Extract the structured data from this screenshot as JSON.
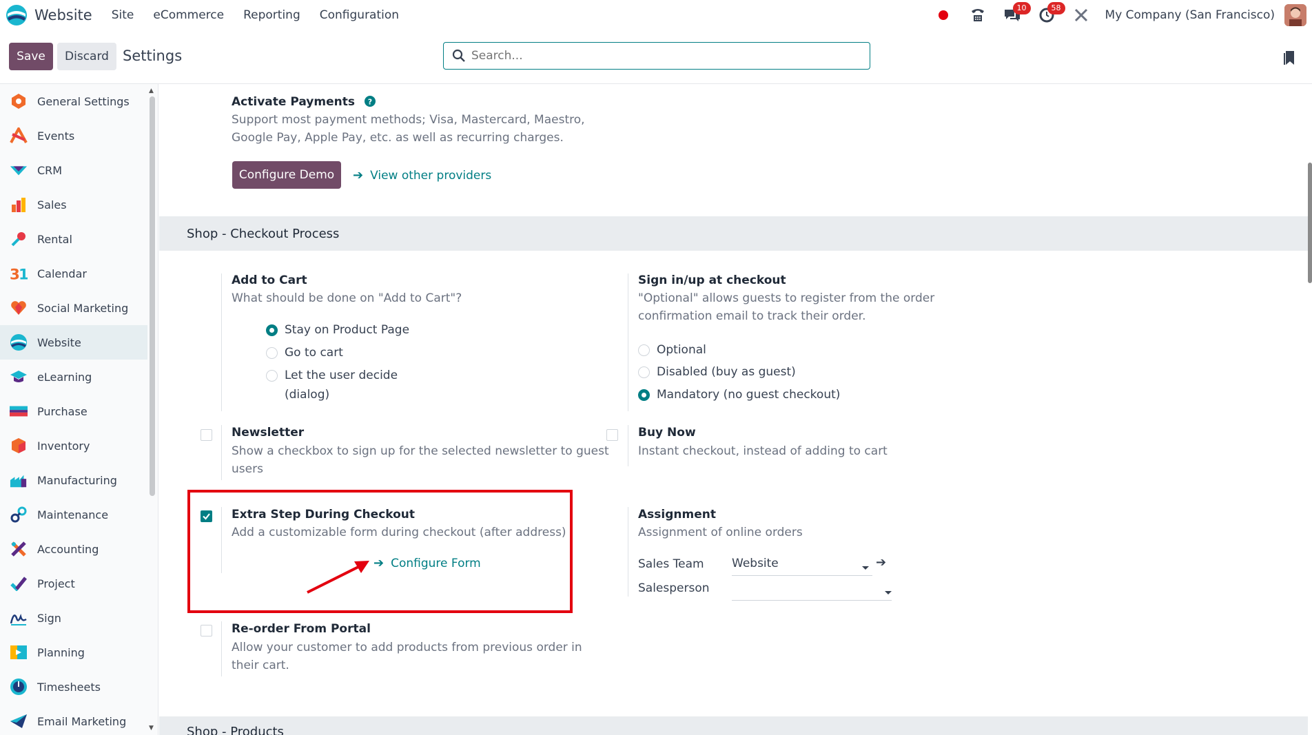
{
  "navbar": {
    "brand": "Website",
    "menus": [
      "Site",
      "eCommerce",
      "Reporting",
      "Configuration"
    ],
    "messages_count": "10",
    "activities_count": "58",
    "company": "My Company (San Francisco)"
  },
  "control": {
    "save": "Save",
    "discard": "Discard",
    "title": "Settings",
    "search_placeholder": "Search..."
  },
  "sidebar": {
    "items": [
      {
        "label": "General Settings",
        "icon": "general-settings-icon"
      },
      {
        "label": "Events",
        "icon": "events-icon"
      },
      {
        "label": "CRM",
        "icon": "crm-icon"
      },
      {
        "label": "Sales",
        "icon": "sales-icon"
      },
      {
        "label": "Rental",
        "icon": "rental-icon"
      },
      {
        "label": "Calendar",
        "icon": "calendar-icon"
      },
      {
        "label": "Social Marketing",
        "icon": "social-marketing-icon"
      },
      {
        "label": "Website",
        "icon": "website-icon"
      },
      {
        "label": "eLearning",
        "icon": "elearning-icon"
      },
      {
        "label": "Purchase",
        "icon": "purchase-icon"
      },
      {
        "label": "Inventory",
        "icon": "inventory-icon"
      },
      {
        "label": "Manufacturing",
        "icon": "manufacturing-icon"
      },
      {
        "label": "Maintenance",
        "icon": "maintenance-icon"
      },
      {
        "label": "Accounting",
        "icon": "accounting-icon"
      },
      {
        "label": "Project",
        "icon": "project-icon"
      },
      {
        "label": "Sign",
        "icon": "sign-icon"
      },
      {
        "label": "Planning",
        "icon": "planning-icon"
      },
      {
        "label": "Timesheets",
        "icon": "timesheets-icon"
      },
      {
        "label": "Email Marketing",
        "icon": "email-marketing-icon"
      }
    ],
    "active": "Website"
  },
  "payments": {
    "title": "Activate Payments",
    "desc1": "Support most payment methods; Visa, Mastercard, Maestro,",
    "desc2": "Google Pay, Apple Pay, etc. as well as recurring charges.",
    "configure_button": "Configure Demo",
    "other_link": "View other providers"
  },
  "checkout_section": {
    "title": "Shop - Checkout Process",
    "add_to_cart": {
      "title": "Add to Cart",
      "desc": "What should be done on \"Add to Cart\"?",
      "options": [
        "Stay on Product Page",
        "Go to cart",
        "Let the user decide",
        "(dialog)"
      ],
      "selected": "Stay on Product Page"
    },
    "signin": {
      "title": "Sign in/up at checkout",
      "desc1": "\"Optional\" allows guests to register from the order",
      "desc2": "confirmation email to track their order.",
      "options": [
        "Optional",
        "Disabled (buy as guest)",
        "Mandatory (no guest checkout)"
      ],
      "selected": "Mandatory (no guest checkout)"
    },
    "newsletter": {
      "title": "Newsletter",
      "desc1": "Show a checkbox to sign up for the selected newsletter to guest",
      "desc2": "users",
      "checked": false
    },
    "buy_now": {
      "title": "Buy Now",
      "desc": "Instant checkout, instead of adding to cart",
      "checked": false
    },
    "extra_step": {
      "title": "Extra Step During Checkout",
      "desc": "Add a customizable form during checkout (after address)",
      "link": "Configure Form",
      "checked": true
    },
    "assignment": {
      "title": "Assignment",
      "desc": "Assignment of online orders",
      "sales_team_label": "Sales Team",
      "sales_team_value": "Website",
      "salesperson_label": "Salesperson",
      "salesperson_value": ""
    },
    "reorder": {
      "title": "Re-order From Portal",
      "desc1": "Allow your customer to add products from previous order in",
      "desc2": "their cart.",
      "checked": false
    }
  },
  "products_section": {
    "title": "Shop - Products"
  },
  "colors": {
    "primary": "#714b67",
    "accent": "#017e84",
    "highlight": "#e3000f"
  }
}
